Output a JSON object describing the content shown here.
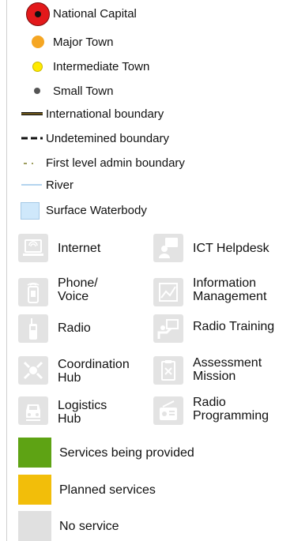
{
  "settlements": {
    "national_capital": "National Capital",
    "major_town": "Major Town",
    "intermediate_town": "Intermediate Town",
    "small_town": "Small Town"
  },
  "boundaries": {
    "international": "International boundary",
    "undetermined": "Undetemined boundary",
    "first_level": "First level admin boundary",
    "river": "River",
    "surface_waterbody": "Surface Waterbody"
  },
  "services": {
    "internet": "Internet",
    "ict_helpdesk": "ICT Helpdesk",
    "phone_voice_line1": "Phone/",
    "phone_voice_line2": "Voice",
    "info_mgmt_line1": "Information",
    "info_mgmt_line2": "Management",
    "radio": "Radio",
    "radio_training": "Radio Training",
    "coord_hub_line1": "Coordination",
    "coord_hub_line2": "Hub",
    "assessment_line1": "Assessment",
    "assessment_line2": "Mission",
    "logistics_line1": "Logistics",
    "logistics_line2": "Hub",
    "radio_prog_line1": "Radio",
    "radio_prog_line2": "Programming"
  },
  "status": {
    "provided": "Services being provided",
    "planned": "Planned services",
    "none": "No service"
  },
  "colors": {
    "capital": "#e3191b",
    "major_town": "#f5a623",
    "intermediate_town": "#ffea00",
    "small_town": "#555555",
    "international_boundary": "#8a6d1f",
    "river": "#9cc6e8",
    "waterbody": "#cfe8fb",
    "provided": "#5ea314",
    "planned": "#f2be0a",
    "none": "#e0e0e0",
    "icon_bg": "#e3e3e3"
  }
}
